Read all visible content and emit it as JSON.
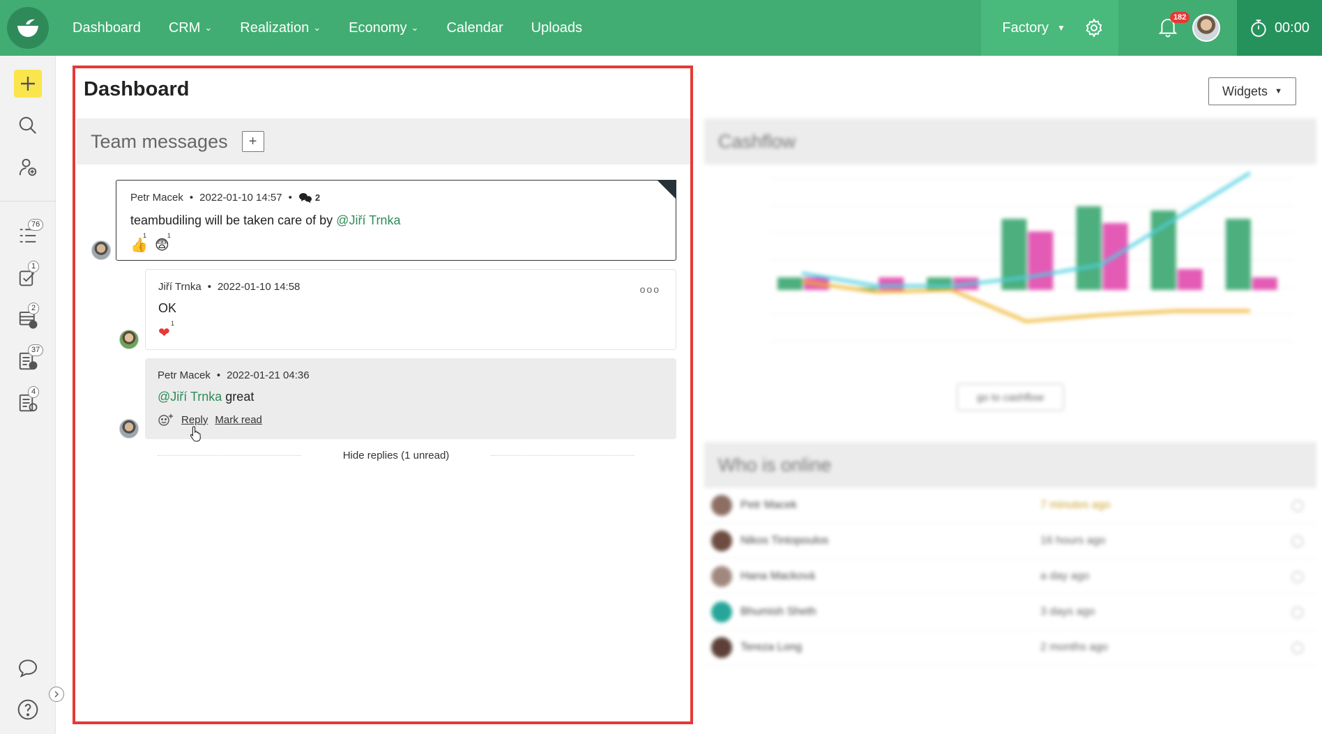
{
  "nav": {
    "items": [
      {
        "label": "Dashboard",
        "has_menu": false
      },
      {
        "label": "CRM",
        "has_menu": true
      },
      {
        "label": "Realization",
        "has_menu": true
      },
      {
        "label": "Economy",
        "has_menu": true
      },
      {
        "label": "Calendar",
        "has_menu": false
      },
      {
        "label": "Uploads",
        "has_menu": false
      }
    ],
    "workspace": "Factory",
    "notifications_count": "182",
    "timer": "00:00"
  },
  "sidebar": {
    "badges": {
      "tasks": "76",
      "approvals": "1",
      "invoices": "2",
      "issues": "37",
      "reports": "4"
    }
  },
  "page": {
    "title": "Dashboard",
    "widgets_label": "Widgets"
  },
  "team_messages": {
    "title": "Team messages",
    "add_label": "+",
    "main": {
      "author": "Petr Macek",
      "date": "2022-01-10 14:57",
      "replies": "2",
      "text_before": "teambudiling will be taken care of by ",
      "mention": "@Jiří Trnka",
      "reactions": [
        {
          "emoji": "👍",
          "count": "1"
        },
        {
          "emoji": "😨",
          "count": "1"
        }
      ]
    },
    "replies": [
      {
        "author": "Jiří Trnka",
        "date": "2022-01-10 14:58",
        "text": "OK",
        "reactions": [
          {
            "emoji": "❤",
            "count": "1"
          }
        ],
        "more": "ooo"
      },
      {
        "author": "Petr Macek",
        "date": "2022-01-21 04:36",
        "mention": "@Jiří Trnka",
        "text": " great",
        "reply_label": "Reply",
        "mark_read_label": "Mark read"
      }
    ],
    "hide_replies": "Hide replies (1 unread)"
  },
  "cashflow": {
    "title": "Cashflow",
    "button": "go to cashflow",
    "colors": {
      "income": "#4caf7d",
      "expense": "#e35bb5",
      "balance": "#4dd0e1",
      "forecast": "#f0b429"
    }
  },
  "who_online": {
    "title": "Who is online",
    "rows": [
      {
        "name": "Petr Macek",
        "time": "7 minutes ago"
      },
      {
        "name": "Nikos Tintopoulos",
        "time": "16 hours ago"
      },
      {
        "name": "Hana Macková",
        "time": "a day ago"
      },
      {
        "name": "Bhumish Sheth",
        "time": "3 days ago"
      },
      {
        "name": "Tereza Long",
        "time": "2 months ago"
      }
    ]
  }
}
